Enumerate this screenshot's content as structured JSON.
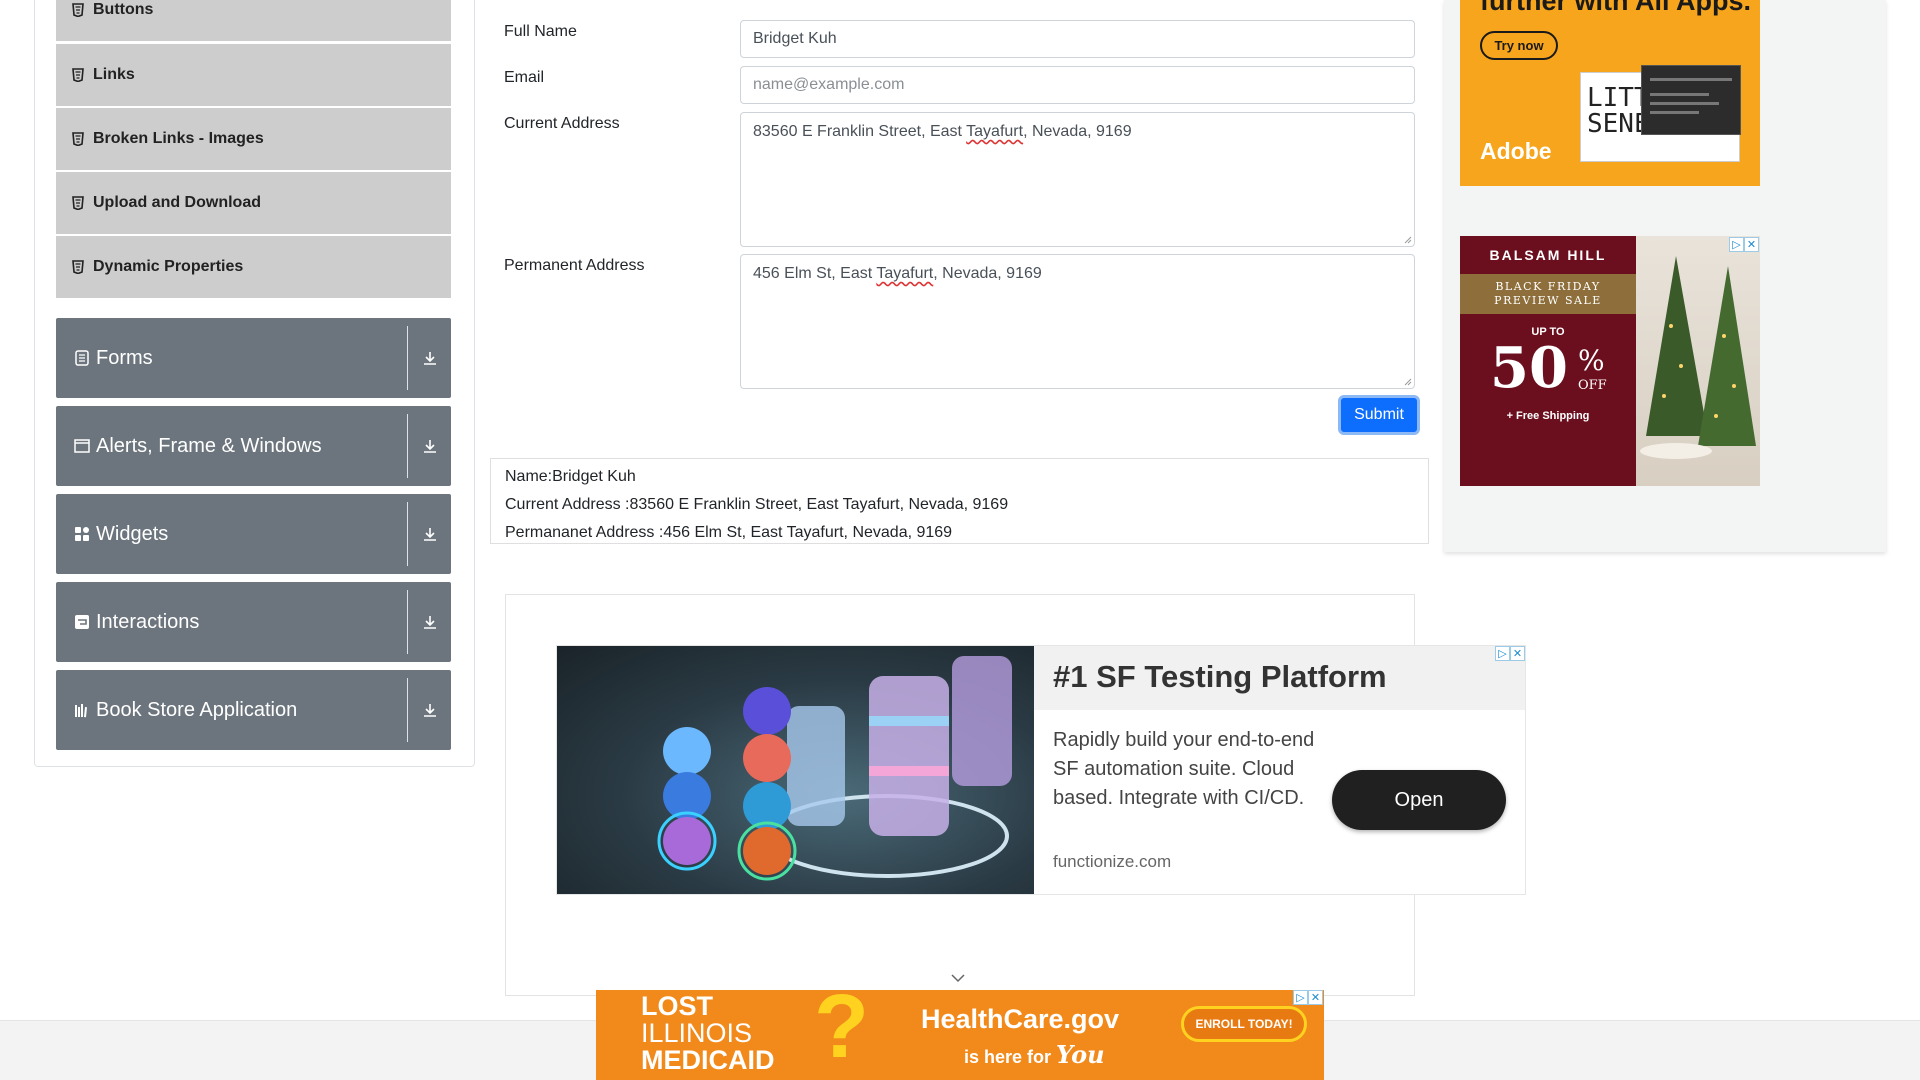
{
  "sidebar": {
    "element_items": [
      {
        "label": "Buttons",
        "icon": "element-list-icon"
      },
      {
        "label": "Links",
        "icon": "element-list-icon"
      },
      {
        "label": "Broken Links - Images",
        "icon": "element-list-icon"
      },
      {
        "label": "Upload and Download",
        "icon": "element-list-icon"
      },
      {
        "label": "Dynamic Properties",
        "icon": "element-list-icon"
      }
    ],
    "groups": [
      {
        "label": "Forms",
        "icon": "forms-icon"
      },
      {
        "label": "Alerts, Frame & Windows",
        "icon": "window-icon"
      },
      {
        "label": "Widgets",
        "icon": "widgets-icon"
      },
      {
        "label": "Interactions",
        "icon": "interactions-icon"
      },
      {
        "label": "Book Store Application",
        "icon": "books-icon"
      }
    ]
  },
  "form": {
    "full_name_label": "Full Name",
    "full_name_value": "Bridget Kuh",
    "email_label": "Email",
    "email_placeholder": "name@example.com",
    "current_address_label": "Current Address",
    "current_address_parts": [
      "83560 E Franklin Street, East ",
      "Tayafurt",
      ", Nevada, 9169"
    ],
    "permanent_address_label": "Permanent Address",
    "permanent_address_parts": [
      "456 Elm St, East ",
      "Tayafurt",
      ", Nevada, 9169"
    ],
    "submit_label": "Submit"
  },
  "output": {
    "name_line": "Name:Bridget Kuh",
    "current_line": "Current Address :83560 E Franklin Street, East Tayafurt, Nevada, 9169",
    "permanent_line": "Permananet Address :456 Elm St, East Tayafurt, Nevada, 9169"
  },
  "ads": {
    "adobe": {
      "headline": "further with All Apps.",
      "cta": "Try now",
      "brand": "Adobe",
      "art_text": [
        "LITTLE",
        "SENEGAL"
      ]
    },
    "balsam": {
      "brand": "BALSAM HILL",
      "banner": [
        "BLACK FRIDAY",
        "PREVIEW SALE"
      ],
      "up_to": "UP TO",
      "percent": "50",
      "percent_sign": "%",
      "off": "OFF",
      "shipping": "+ Free Shipping"
    },
    "functionize": {
      "title": "#1 SF Testing Platform",
      "body": "Rapidly build your end-to-end SF automation suite. Cloud based. Integrate with CI/CD.",
      "domain": "functionize.com",
      "cta": "Open"
    },
    "healthcare": {
      "left": [
        "LOST",
        "ILLINOIS",
        "MEDICAID"
      ],
      "question": "?",
      "brand": "HealthCare.gov",
      "tagline": "is here for",
      "tagline_script": "You",
      "cta": "ENROLL TODAY!"
    }
  },
  "colors": {
    "accent": "#0d6efd",
    "sidebar_group": "#6c757d",
    "sidebar_item": "#cdcdcd"
  }
}
